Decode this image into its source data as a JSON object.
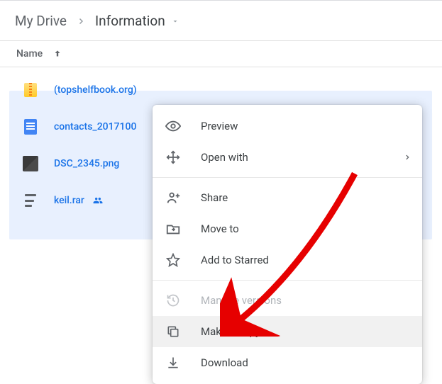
{
  "breadcrumb": {
    "root": "My Drive",
    "current": "Information"
  },
  "columns": {
    "name": "Name"
  },
  "files": [
    {
      "name": "(topshelfbook.org)",
      "icon": "zip",
      "shared": false
    },
    {
      "name": "contacts_2017100",
      "icon": "doc",
      "shared": false
    },
    {
      "name": "DSC_2345.png",
      "icon": "image",
      "shared": false
    },
    {
      "name": "keil.rar",
      "icon": "rar",
      "shared": true
    }
  ],
  "context_menu": {
    "preview": "Preview",
    "open_with": "Open with",
    "share": "Share",
    "move_to": "Move to",
    "add_to_starred": "Add to Starred",
    "manage_versions": "Manage versions",
    "make_a_copy": "Make a copy",
    "download": "Download"
  }
}
